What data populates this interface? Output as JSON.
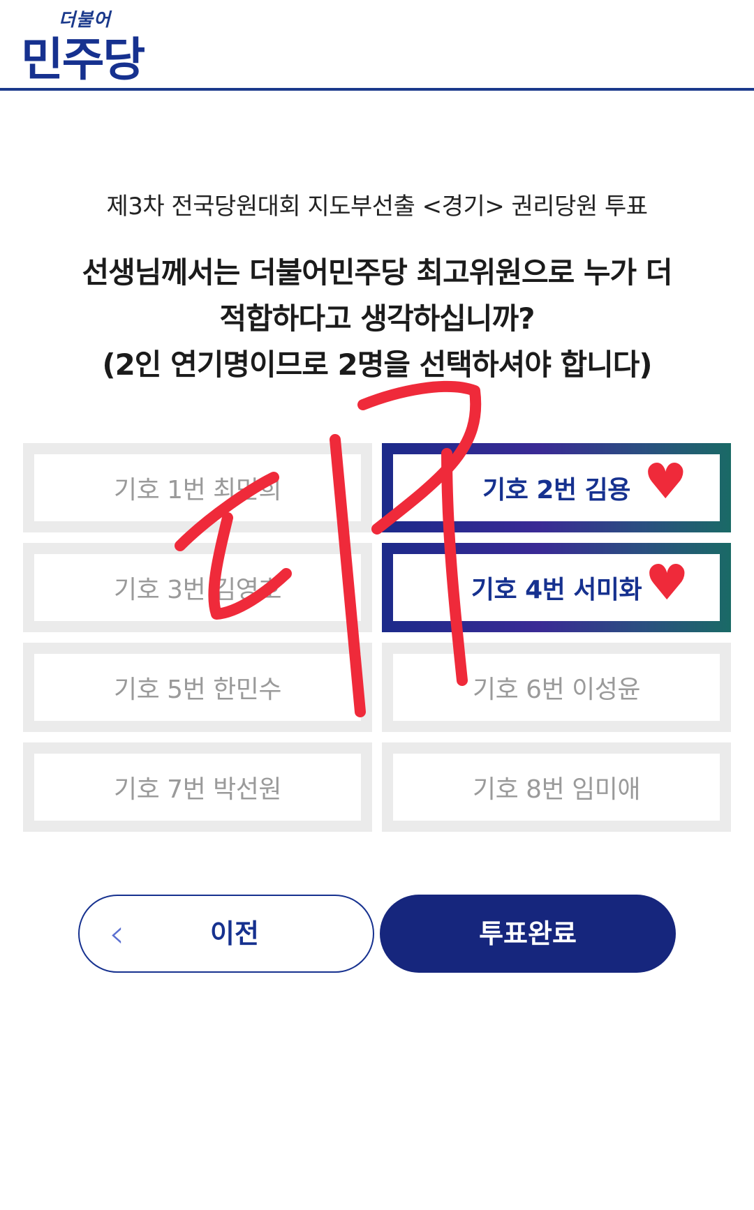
{
  "header": {
    "logo_small": "더불어",
    "logo_big": "민주당"
  },
  "subtitle": "제3차 전국당원대회 지도부선출 <경기> 권리당원 투표",
  "question": {
    "line1": "선생님께서는 더불어민주당 최고위원으로 누가 더",
    "line2": "적합하다고 생각하십니까?",
    "line3": "(2인 연기명이므로 2명을 선택하셔야 합니다)"
  },
  "candidates": [
    {
      "label": "기호 1번 최민희",
      "selected": false
    },
    {
      "label": "기호 2번 김용",
      "selected": true
    },
    {
      "label": "기호 3번 김영호",
      "selected": false
    },
    {
      "label": "기호 4번 서미화",
      "selected": true
    },
    {
      "label": "기호 5번 한민수",
      "selected": false
    },
    {
      "label": "기호 6번 이성윤",
      "selected": false
    },
    {
      "label": "기호 7번 박선원",
      "selected": false
    },
    {
      "label": "기호 8번 임미애",
      "selected": false
    }
  ],
  "buttons": {
    "prev_label": "이전",
    "done_label": "투표완료"
  },
  "colors": {
    "brand": "#16318f",
    "annotation": "#ef2a3a"
  }
}
